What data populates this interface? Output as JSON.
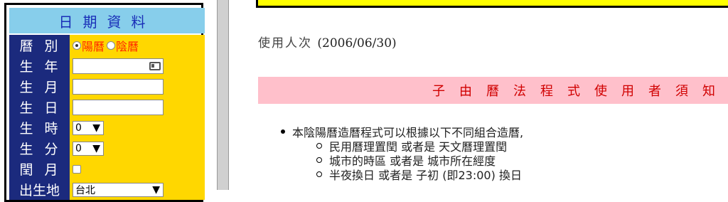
{
  "form": {
    "header": "日期資料",
    "rows": {
      "calendar": {
        "label": "曆別",
        "options": [
          "陽曆",
          "陰曆"
        ],
        "selected": "陽曆"
      },
      "year": {
        "label": "生年",
        "value": ""
      },
      "month": {
        "label": "生月",
        "value": ""
      },
      "day": {
        "label": "生日",
        "value": ""
      },
      "hour": {
        "label": "生時",
        "value": "0"
      },
      "minute": {
        "label": "生分",
        "value": "0"
      },
      "leap": {
        "label": "閏月",
        "checked": false
      },
      "place": {
        "label": "出生地",
        "value": "台北"
      }
    }
  },
  "content": {
    "usage_label": "使用人次",
    "usage_date": "(2006/06/30)",
    "section_title": "子由曆法程式使用者須知",
    "bullet": "本陰陽曆造曆程式可以根據以下不同組合造曆,",
    "subitems": [
      "民用曆理置閏 或者是 天文曆理置閏",
      "城市的時區 或者是 城市所在經度",
      "半夜換日 或者是 子初 (即23:00) 換日"
    ]
  },
  "colors": {
    "header_bg": "#87ceeb",
    "label_bg": "#1b2a7d",
    "value_bg": "#ffd700",
    "title_bg": "#ffc0cb",
    "title_fg": "#d00000",
    "notice_bg": "#ffff00"
  }
}
